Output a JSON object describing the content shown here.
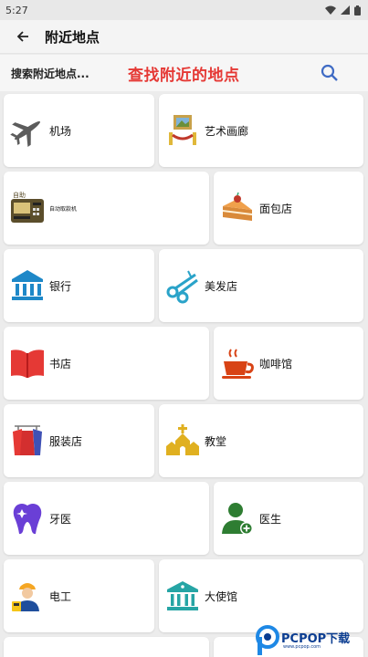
{
  "status_bar": {
    "time": "5:27"
  },
  "app_bar": {
    "title": "附近地点"
  },
  "search": {
    "placeholder": "搜索附近地点...",
    "hint": "查找附近的地点"
  },
  "places": [
    {
      "label": "机场",
      "icon": "airplane-icon"
    },
    {
      "label": "艺术画廊",
      "icon": "art-gallery-icon"
    },
    {
      "label": "自动取款机",
      "icon": "atm-icon"
    },
    {
      "label": "面包店",
      "icon": "cake-icon"
    },
    {
      "label": "银行",
      "icon": "bank-icon"
    },
    {
      "label": "美发店",
      "icon": "scissors-icon"
    },
    {
      "label": "书店",
      "icon": "book-icon"
    },
    {
      "label": "咖啡馆",
      "icon": "coffee-cup-icon"
    },
    {
      "label": "服装店",
      "icon": "clothing-icon"
    },
    {
      "label": "教堂",
      "icon": "church-icon"
    },
    {
      "label": "牙医",
      "icon": "tooth-icon"
    },
    {
      "label": "医生",
      "icon": "doctor-icon"
    },
    {
      "label": "电工",
      "icon": "electrician-icon"
    },
    {
      "label": "大使馆",
      "icon": "embassy-icon"
    }
  ],
  "watermark": {
    "text": "PCPOP下载",
    "subtext": "www.pcpop.com"
  }
}
